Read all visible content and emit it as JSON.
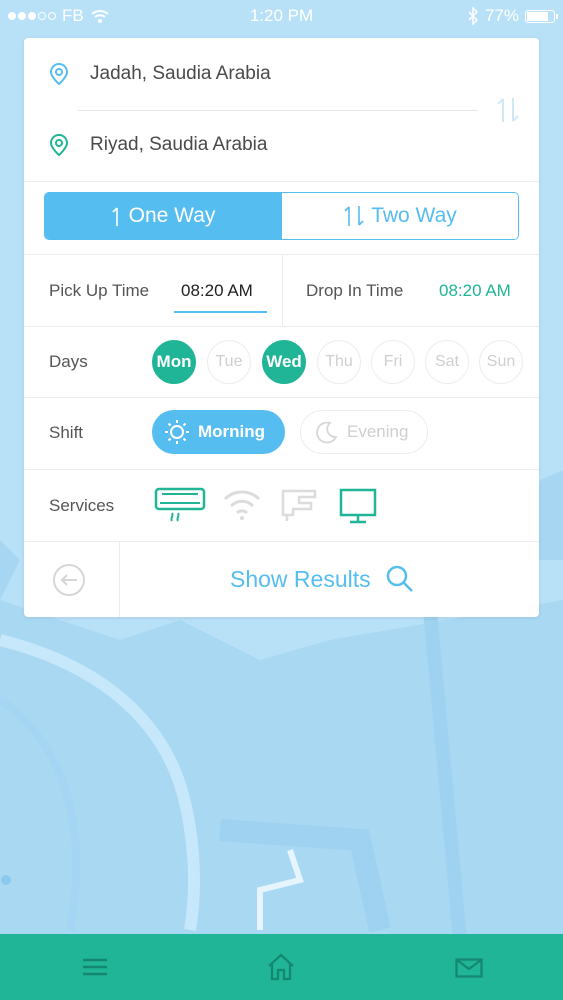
{
  "status_bar": {
    "carrier": "FB",
    "time": "1:20 PM",
    "battery": "77%"
  },
  "route": {
    "from": "Jadah, Saudia Arabia",
    "to": "Riyad, Saudia Arabia"
  },
  "trip_type": {
    "options": [
      "One Way",
      "Two Way"
    ],
    "selected": "One Way"
  },
  "times": {
    "pickup_label": "Pick Up Time",
    "pickup_value": "08:20 AM",
    "drop_label": "Drop In Time",
    "drop_value": "08:20 AM"
  },
  "days": {
    "label": "Days",
    "items": [
      "Mon",
      "Tue",
      "Wed",
      "Thu",
      "Fri",
      "Sat",
      "Sun"
    ],
    "selected": [
      "Mon",
      "Wed"
    ]
  },
  "shift": {
    "label": "Shift",
    "options": [
      "Morning",
      "Evening"
    ],
    "selected": "Morning"
  },
  "services": {
    "label": "Services",
    "icons": [
      "air-conditioner-icon",
      "wifi-icon",
      "seat-icon",
      "tv-icon"
    ]
  },
  "actions": {
    "show_results": "Show Results"
  },
  "nav": {
    "icons": [
      "menu-icon",
      "home-icon",
      "mail-icon"
    ]
  },
  "colors": {
    "accent_blue": "#56bdf0",
    "accent_green": "#1fb596",
    "map_bg": "#b8e0f7"
  }
}
